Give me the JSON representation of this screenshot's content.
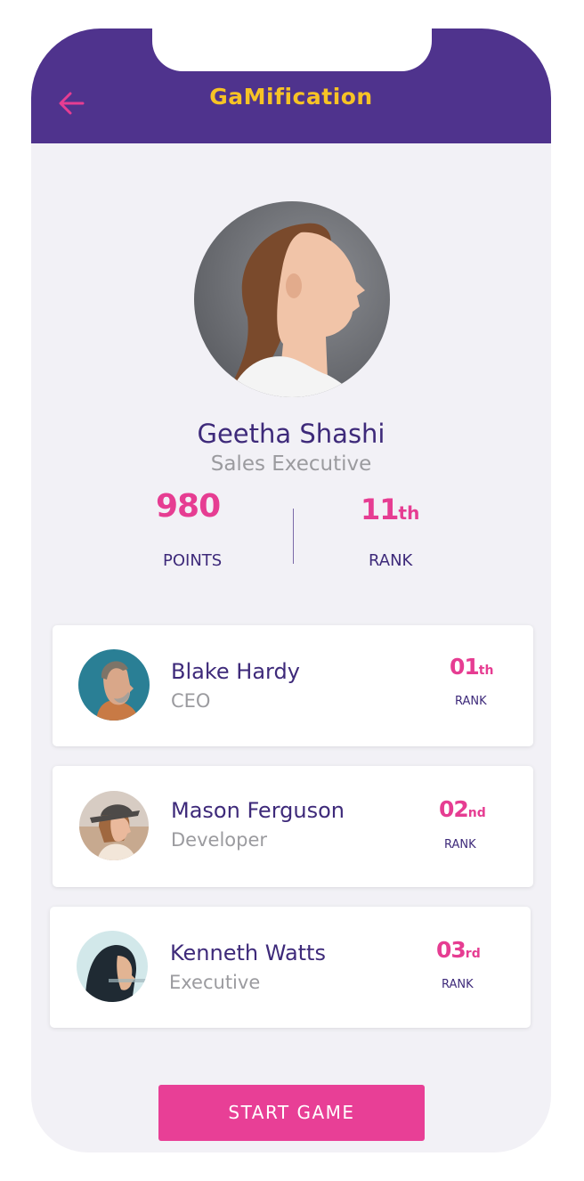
{
  "header": {
    "title": "GaMification",
    "back_icon": "arrow-left-icon",
    "background_color": "#4f338d",
    "title_color": "#f7c325"
  },
  "profile": {
    "name": "Geetha Shashi",
    "role": "Sales Executive",
    "points_value": "980",
    "points_label": "POINTS",
    "rank_value": "11",
    "rank_suffix": "th",
    "rank_label": "RANK"
  },
  "leaderboard": [
    {
      "name": "Blake Hardy",
      "role": "CEO",
      "rank_value": "01",
      "rank_suffix": "th",
      "rank_label": "RANK"
    },
    {
      "name": "Mason Ferguson",
      "role": "Developer",
      "rank_value": "02",
      "rank_suffix": "nd",
      "rank_label": "RANK"
    },
    {
      "name": "Kenneth Watts",
      "role": "Executive",
      "rank_value": "03",
      "rank_suffix": "rd",
      "rank_label": "RANK"
    }
  ],
  "start_button": {
    "label": "START GAME",
    "color": "#e83f96"
  },
  "colors": {
    "accent": "#e63d92",
    "text_primary": "#3e2a7a",
    "text_secondary": "#9b9b9f",
    "background": "#f2f1f6"
  }
}
